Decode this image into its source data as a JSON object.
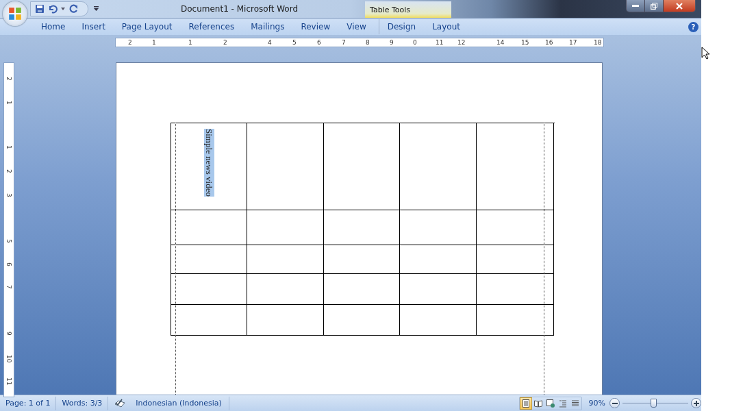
{
  "window": {
    "title": "Document1 - Microsoft Word"
  },
  "contextual_group": {
    "label": "Table Tools"
  },
  "help_button": {
    "label": "?"
  },
  "tabs": [
    {
      "label": "Home"
    },
    {
      "label": "Insert"
    },
    {
      "label": "Page Layout"
    },
    {
      "label": "References"
    },
    {
      "label": "Mailings"
    },
    {
      "label": "Review"
    },
    {
      "label": "View"
    }
  ],
  "contextual_tabs": [
    {
      "label": "Design"
    },
    {
      "label": "Layout"
    }
  ],
  "horizontal_ruler": {
    "labels": [
      "2",
      "1",
      "1",
      "2",
      "4",
      "5",
      "6",
      "7",
      "8",
      "9",
      "0",
      "11",
      "12",
      "14",
      "15",
      "16",
      "17",
      "18"
    ]
  },
  "vertical_ruler": {
    "labels": [
      "2",
      "1",
      "1",
      "2",
      "3",
      "5",
      "6",
      "7",
      "9",
      "10",
      "11"
    ]
  },
  "table": {
    "first_cell": {
      "text": "Simple news video",
      "selected": true
    }
  },
  "status_bar": {
    "page": "Page: 1 of 1",
    "words": "Words: 3/3",
    "language": "Indonesian (Indonesia)",
    "views": [
      {
        "kind": "print",
        "selected": true
      },
      {
        "kind": "reading",
        "selected": false
      },
      {
        "kind": "web",
        "selected": false
      },
      {
        "kind": "outline",
        "selected": false
      },
      {
        "kind": "draft",
        "selected": false
      }
    ],
    "zoom": "90%",
    "zoom_slider": {
      "level": 0.46
    }
  }
}
